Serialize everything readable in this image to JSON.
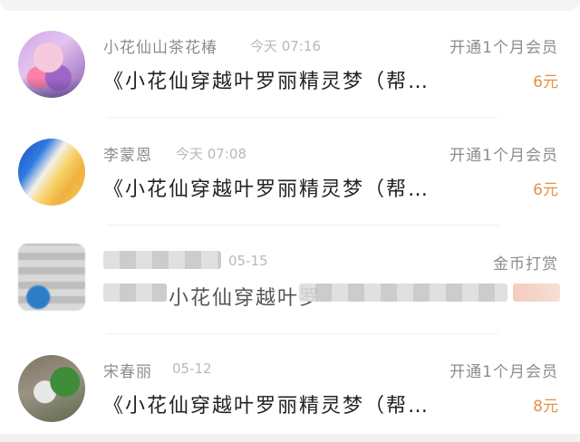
{
  "rows": [
    {
      "name": "小花仙山茶花椿",
      "time": "今天 07:16",
      "tag": "开通1个月会员",
      "title": "《小花仙穿越叶罗丽精灵梦（帮…",
      "price": "6元"
    },
    {
      "name": "李蒙恩",
      "time": "今天 07:08",
      "tag": "开通1个月会员",
      "title": "《小花仙穿越叶罗丽精灵梦（帮…",
      "price": "6元"
    },
    {
      "name": "",
      "time": "05-15",
      "tag": "金币打赏",
      "title": "小花仙穿越叶罗",
      "price": ""
    },
    {
      "name": "宋春丽",
      "time": "05-12",
      "tag": "开通1个月会员",
      "title": "《小花仙穿越叶罗丽精灵梦（帮…",
      "price": "8元"
    }
  ],
  "colors": {
    "price": "#e3924a",
    "muted": "#8c8c8c",
    "title": "#222222"
  }
}
